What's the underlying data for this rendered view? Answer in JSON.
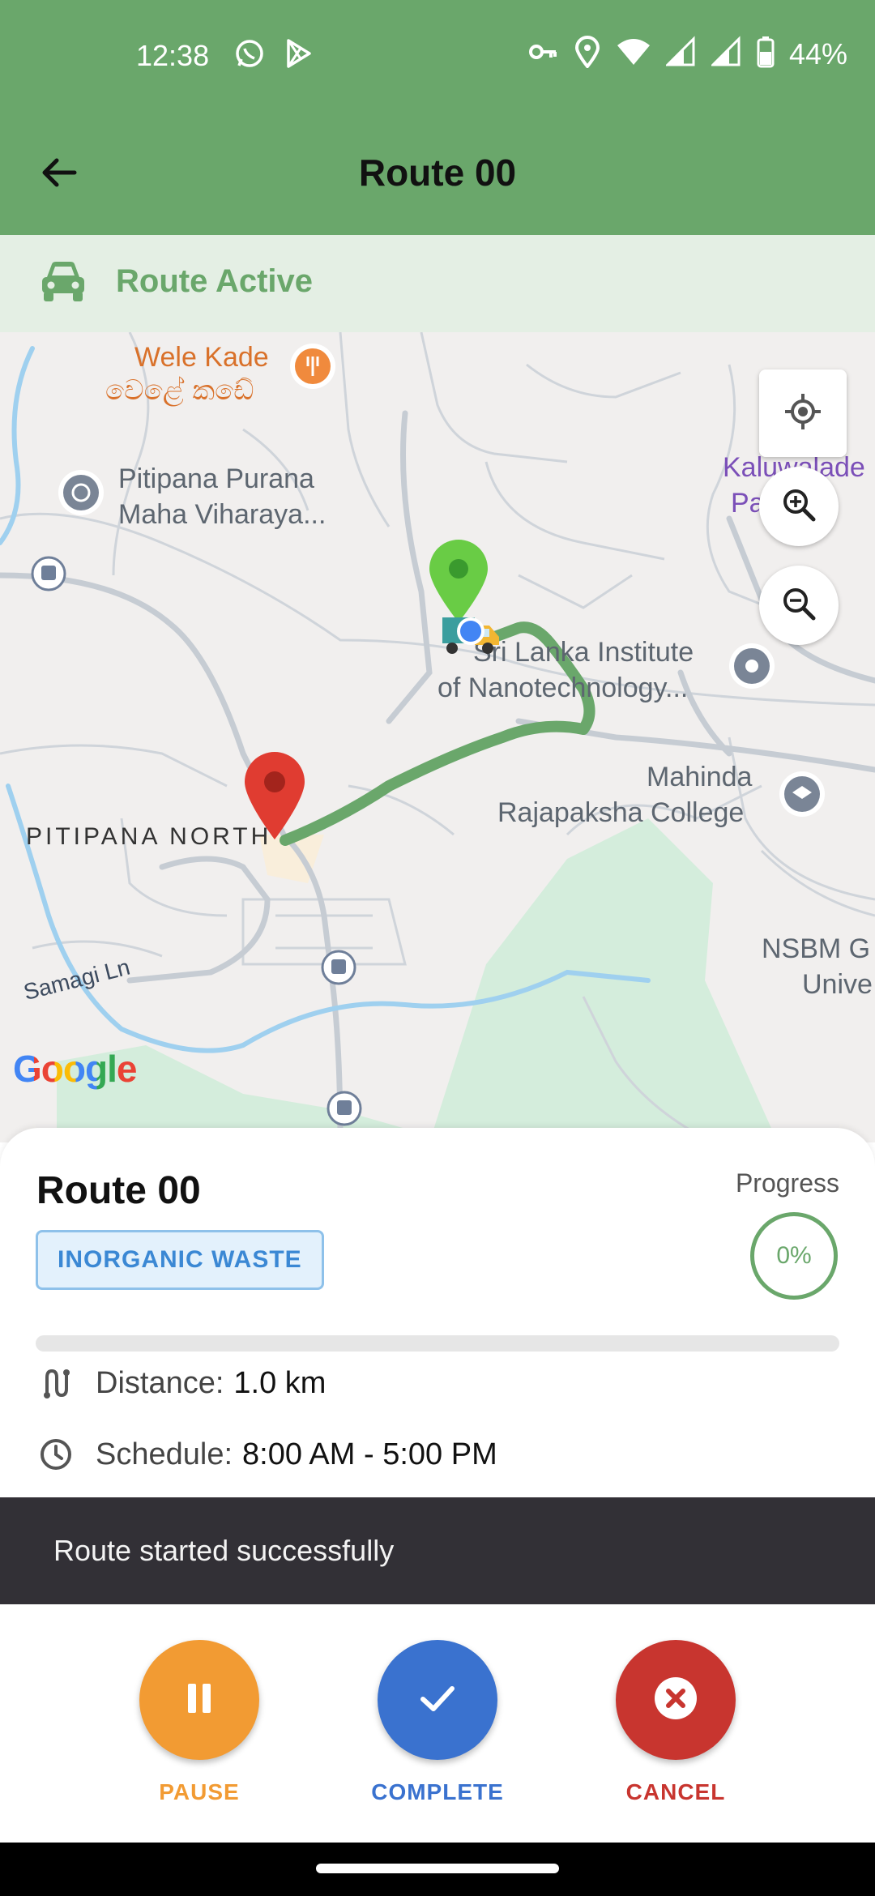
{
  "status_bar": {
    "time": "12:38",
    "battery": "44%",
    "icons": [
      "whatsapp-icon",
      "play-store-icon",
      "vpn-key-icon",
      "location-icon",
      "wifi-icon",
      "signal-icon",
      "signal-icon",
      "battery-icon"
    ]
  },
  "app_bar": {
    "title": "Route 00",
    "back_icon": "arrow-back-icon"
  },
  "banner": {
    "icon": "car-icon",
    "text": "Route Active"
  },
  "map": {
    "labels": {
      "wele_kade_en": "Wele Kade",
      "wele_kade_si": "වෙළේ කඩේ",
      "temple_line1": "Pitipana Purana",
      "temple_line2": "Maha Viharaya...",
      "institute_line1": "Sri Lanka Institute",
      "institute_line2": "of Nanotechnology...",
      "college_line1": "Mahinda",
      "college_line2": "Rajapaksha College",
      "area": "PITIPANA NORTH",
      "kaluwalade_line1": "Kaluwalade",
      "kaluwalade_line2": "Pa   Kud",
      "nsbm_line1": "NSBM G",
      "nsbm_line2": "Unive",
      "road": "Samagi Ln",
      "attribution": "Google"
    },
    "controls": {
      "my_location": "my-location-icon",
      "zoom_in": "zoom-in-icon",
      "zoom_out": "zoom-out-icon"
    }
  },
  "route_card": {
    "title": "Route 00",
    "waste_type": "INORGANIC WASTE",
    "progress_label": "Progress",
    "progress_value": "0%",
    "progress_fraction": 0,
    "distance_label": "Distance:",
    "distance_value": "1.0 km",
    "schedule_label": "Schedule:",
    "schedule_value": "8:00 AM - 5:00 PM"
  },
  "snackbar": {
    "message": "Route started successfully"
  },
  "actions": {
    "pause": {
      "label": "PAUSE",
      "color": "#f29b33"
    },
    "complete": {
      "label": "COMPLETE",
      "color": "#3a72cf"
    },
    "cancel": {
      "label": "CANCEL",
      "color": "#c8352f"
    }
  },
  "colors": {
    "primary": "#6aa76b",
    "banner_bg": "#e4efe4",
    "badge_text": "#3b88d4"
  }
}
